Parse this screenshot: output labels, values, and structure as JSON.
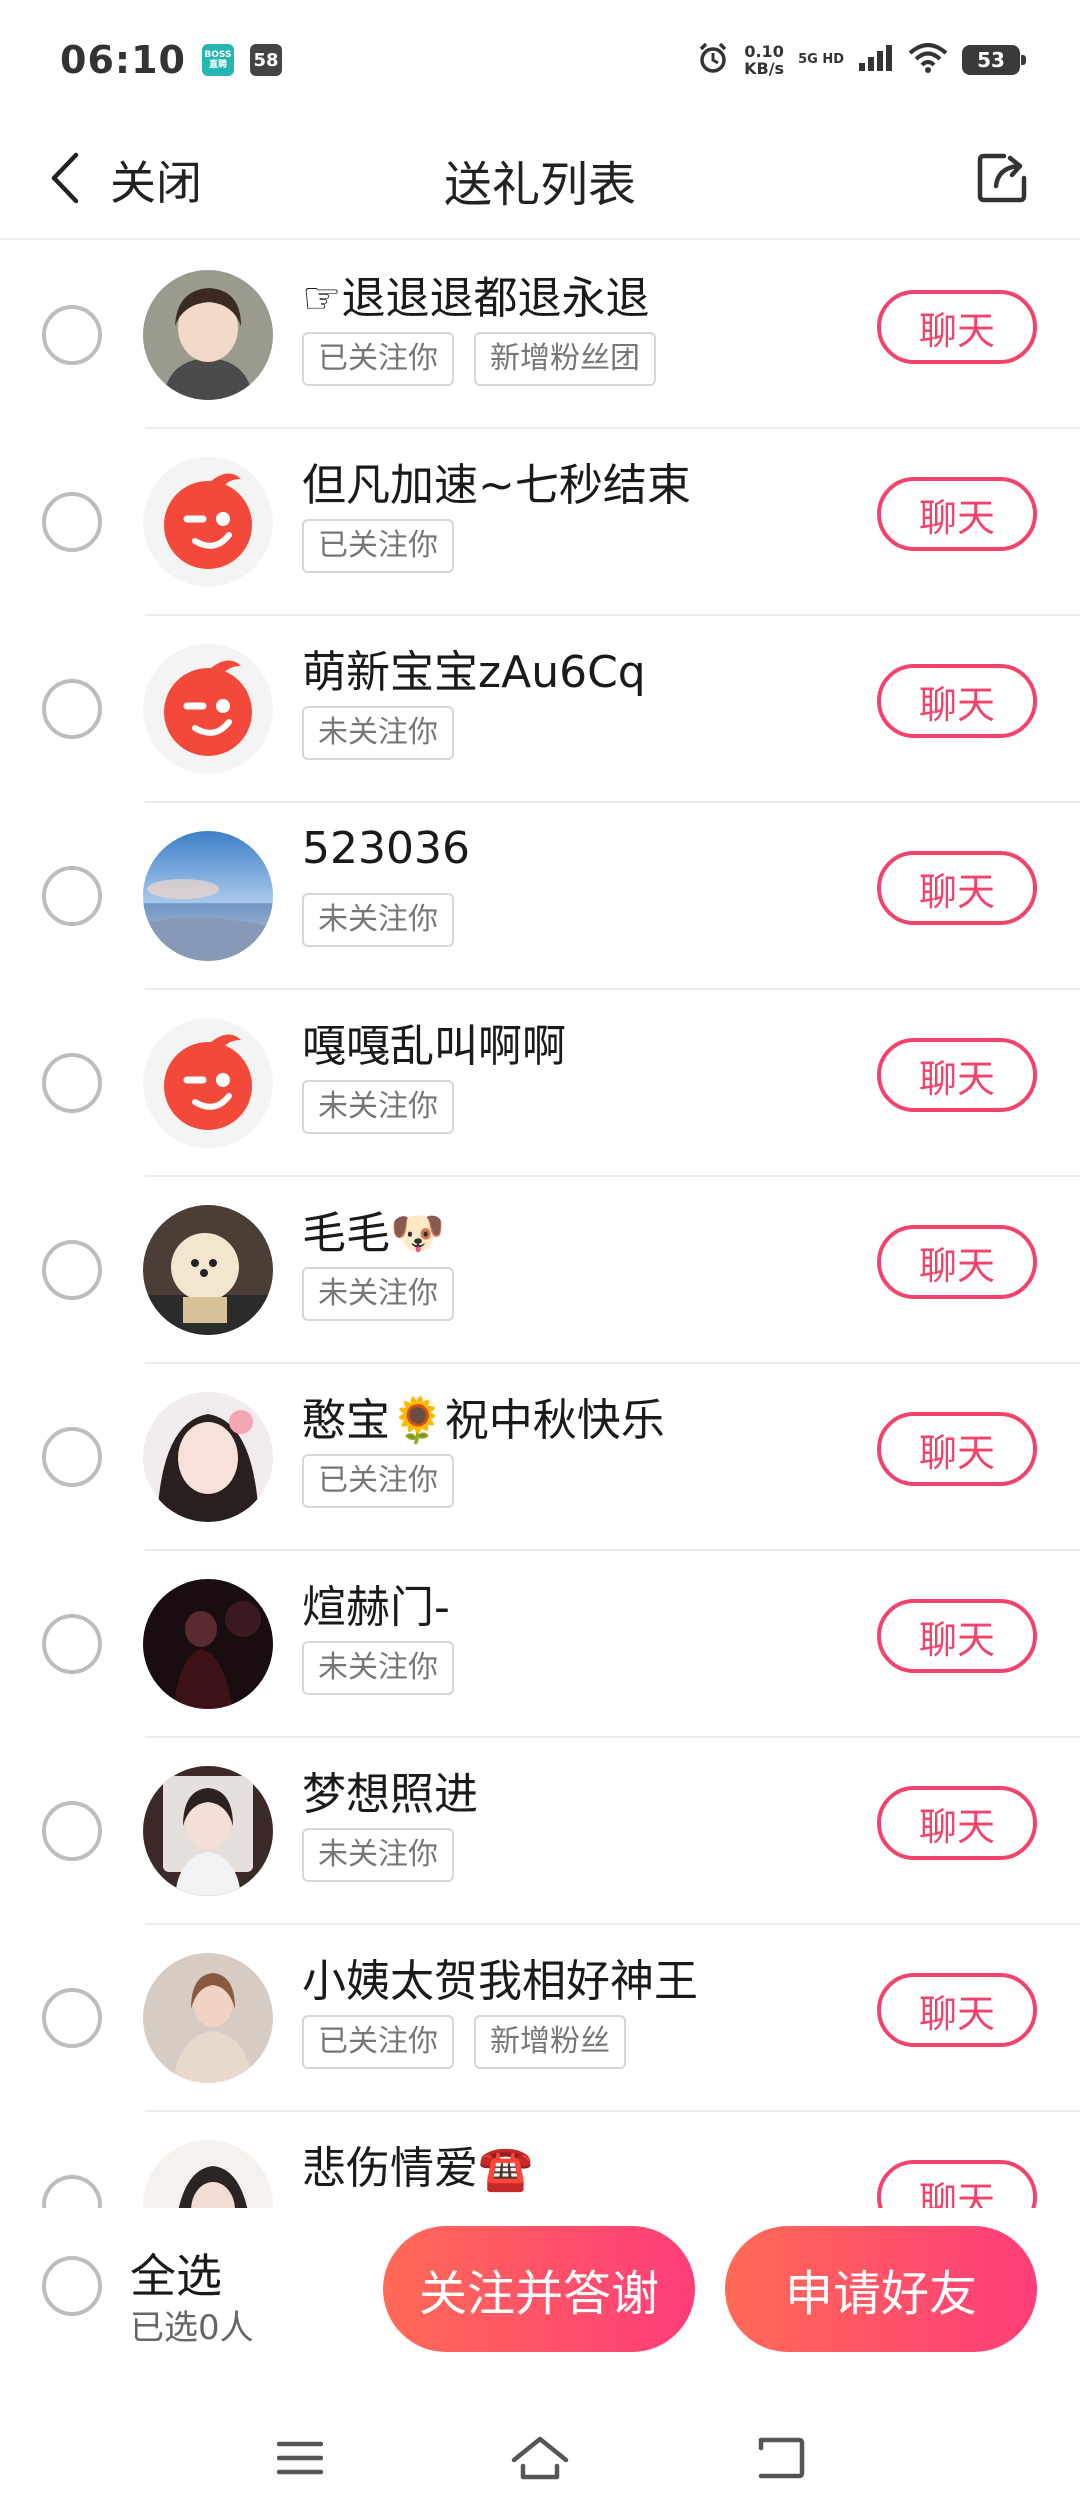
{
  "status_bar": {
    "time": "06:10",
    "app_icons": [
      "BOSS直聘",
      "58"
    ],
    "net_speed_value": "0.10",
    "net_speed_unit": "KB/s",
    "network_type": "5G HD",
    "battery": "53"
  },
  "header": {
    "close_label": "关闭",
    "title": "送礼列表"
  },
  "list": {
    "chat_label": "聊天",
    "rows": [
      {
        "name": "☞退退退都退永退",
        "tags": [
          "已关注你",
          "新增粉丝团"
        ],
        "avatar": "photo-girl-1"
      },
      {
        "name": "但凡加速~七秒结束",
        "tags": [
          "已关注你"
        ],
        "avatar": "default-wink"
      },
      {
        "name": "萌新宝宝zAu6Cq",
        "tags": [
          "未关注你"
        ],
        "avatar": "default-wink"
      },
      {
        "name": "523036",
        "tags": [
          "未关注你"
        ],
        "avatar": "photo-sea"
      },
      {
        "name": "嘎嘎乱叫啊啊",
        "tags": [
          "未关注你"
        ],
        "avatar": "default-wink"
      },
      {
        "name": "毛毛🐶",
        "tags": [
          "未关注你"
        ],
        "avatar": "photo-dog"
      },
      {
        "name": "憨宝🌻祝中秋快乐",
        "tags": [
          "已关注你"
        ],
        "avatar": "photo-girl-2"
      },
      {
        "name": "煊赫门-",
        "tags": [
          "未关注你"
        ],
        "avatar": "photo-dark"
      },
      {
        "name": "梦想照进",
        "tags": [
          "未关注你"
        ],
        "avatar": "photo-girl-3"
      },
      {
        "name": "小姨太贺我相好神王",
        "tags": [
          "已关注你",
          "新增粉丝"
        ],
        "avatar": "photo-girl-4"
      },
      {
        "name": "悲伤情爱☎️",
        "tags": [],
        "avatar": "photo-girl-5"
      }
    ]
  },
  "bottom_bar": {
    "select_all_label": "全选",
    "selected_count": "已选0人",
    "follow_thank_label": "关注并答谢",
    "friend_request_label": "申请好友"
  },
  "colors": {
    "accent": "#f2436d",
    "gradient_start": "#ff6a55",
    "gradient_end": "#ff3d7a",
    "default_avatar_red": "#f2493a"
  },
  "icons": {
    "back": "chevron-left-icon",
    "share": "share-icon",
    "nav_menu": "menu-icon",
    "nav_home": "home-icon",
    "nav_back": "back-icon"
  }
}
